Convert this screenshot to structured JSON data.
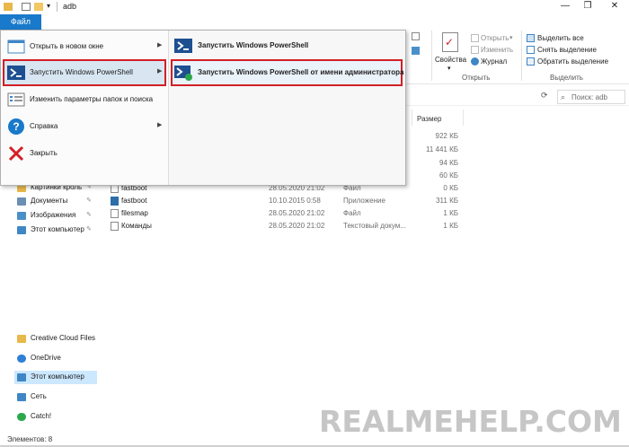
{
  "window": {
    "title": "adb",
    "minimize": "—",
    "restore": "❐",
    "close": "✕"
  },
  "ribbon": {
    "file_tab": "Файл",
    "properties_label": "Свойства",
    "open_label": "Открыть",
    "edit_label": "Изменить",
    "journal_label": "Журнал",
    "open_group": "Открыть",
    "select_all": "Выделить все",
    "deselect": "Снять выделение",
    "invert_selection": "Обратить выделение",
    "select_group": "Выделить",
    "search_placeholder": "Поиск: adb"
  },
  "file_menu": {
    "items": [
      {
        "label": "Открыть в новом окне",
        "icon": "window-icon",
        "has_arrow": true
      },
      {
        "label": "Запустить Windows PowerShell",
        "icon": "powershell-icon",
        "has_arrow": true
      },
      {
        "label": "Изменить параметры папок и поиска",
        "icon": "options-icon",
        "has_arrow": false
      },
      {
        "label": "Справка",
        "icon": "help-icon",
        "has_arrow": true
      },
      {
        "label": "Закрыть",
        "icon": "close-red-icon",
        "has_arrow": false
      }
    ],
    "submenu": [
      {
        "label": "Запустить Windows PowerShell",
        "icon": "powershell-icon"
      },
      {
        "label": "Запустить Windows PowerShell от имени администратора",
        "icon": "powershell-admin-icon"
      }
    ]
  },
  "columns": {
    "size": "Размер"
  },
  "hidden_sizes": [
    "922 КБ",
    "11 441 КБ",
    "94 КБ",
    "60 КБ"
  ],
  "files": [
    {
      "name": "fastboot",
      "date": "28.05.2020 21:02",
      "type": "Файл",
      "size": "0 КБ"
    },
    {
      "name": "fastboot",
      "date": "10.10.2015 0:58",
      "type": "Приложение",
      "size": "311 КБ"
    },
    {
      "name": "filesmap",
      "date": "28.05.2020 21:02",
      "type": "Файл",
      "size": "1 КБ"
    },
    {
      "name": "Команды",
      "date": "28.05.2020 21:02",
      "type": "Текстовый докум...",
      "size": "1 КБ"
    }
  ],
  "nav": {
    "quick": [
      {
        "label": "Картинки кроль",
        "pinned": true,
        "icon": "pictures-folder-icon",
        "color": "#e8b84a"
      },
      {
        "label": "Документы",
        "pinned": true,
        "icon": "documents-icon",
        "color": "#6b8fb3"
      },
      {
        "label": "Изображения",
        "pinned": true,
        "icon": "images-icon",
        "color": "#4a90c8"
      },
      {
        "label": "Этот компьютер",
        "pinned": true,
        "icon": "computer-icon",
        "color": "#3f86c6"
      }
    ],
    "locations": [
      {
        "label": "Creative Cloud Files",
        "icon": "creative-cloud-icon",
        "color": "#e8b84a",
        "selected": false
      },
      {
        "label": "OneDrive",
        "icon": "onedrive-icon",
        "color": "#2f7fd6",
        "selected": false
      },
      {
        "label": "Этот компьютер",
        "icon": "computer-icon",
        "color": "#3f86c6",
        "selected": true
      },
      {
        "label": "Сеть",
        "icon": "network-icon",
        "color": "#3f86c6",
        "selected": false
      },
      {
        "label": "Catch!",
        "icon": "catch-icon",
        "color": "#2ba84a",
        "selected": false
      }
    ]
  },
  "status": {
    "items_count": "Элементов: 8"
  },
  "watermark": "REALMEHELP.COM",
  "colors": {
    "accent": "#1979ca",
    "highlight_border": "#d21f26"
  }
}
